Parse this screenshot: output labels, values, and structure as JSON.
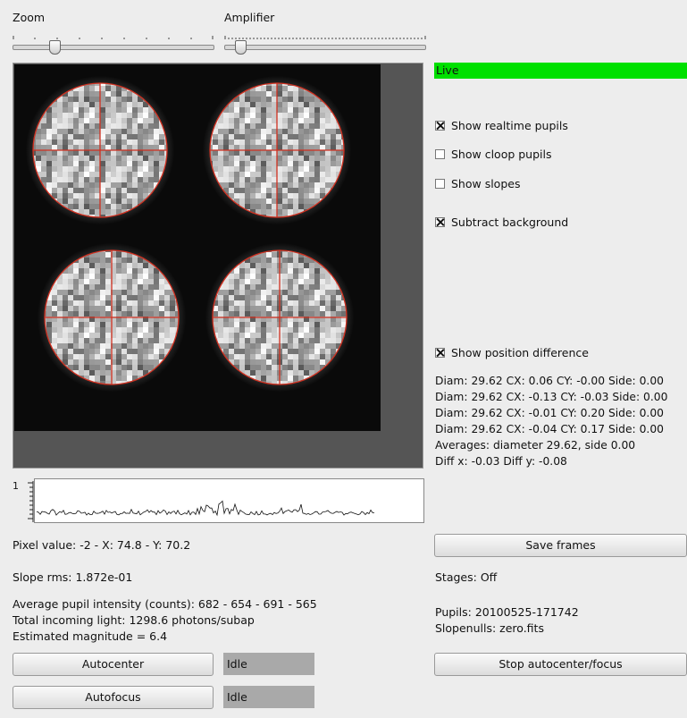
{
  "controls": {
    "zoom_label": "Zoom",
    "zoom_level": 0.21,
    "amplifier_label": "Amplifier",
    "amplifier_level": 0.08
  },
  "status": {
    "live_label": "Live",
    "live_color": "#00e000"
  },
  "options": [
    {
      "label": "Show realtime pupils",
      "checked": true
    },
    {
      "label": "Show cloop pupils",
      "checked": false
    },
    {
      "label": "Show slopes",
      "checked": false
    },
    {
      "label": "Subtract background",
      "checked": true
    }
  ],
  "position_diff": {
    "label": "Show position difference",
    "checked": true,
    "lines": [
      "Diam: 29.62 CX:  0.06  CY: -0.00 Side: 0.00",
      "Diam: 29.62 CX: -0.13  CY: -0.03 Side: 0.00",
      "Diam: 29.62 CX: -0.01  CY:  0.20 Side: 0.00",
      "Diam: 29.62 CX: -0.04  CY:  0.17 Side: 0.00",
      "Averages: diameter 29.62, side  0.00",
      "Diff x: -0.03 Diff y: -0.08"
    ]
  },
  "plot": {
    "ytick": "1"
  },
  "readouts": {
    "pixel_value": "Pixel value: -2 - X:  74.8 - Y:  70.2",
    "slope_rms": "Slope rms: 1.872e-01",
    "avg_intensity": "Average pupil intensity (counts): 682 - 654 - 691 - 565",
    "total_light": "Total incoming light: 1298.6 photons/subap",
    "magnitude": "Estimated magnitude =   6.4"
  },
  "buttons": {
    "save_frames": "Save frames",
    "autocenter": "Autocenter",
    "autofocus": "Autofocus",
    "stop_autocenter": "Stop autocenter/focus"
  },
  "states": {
    "autocenter_state": "Idle",
    "autofocus_state": "Idle"
  },
  "info": {
    "stages": "Stages: Off",
    "pupils": "Pupils: 20100525-171742",
    "slopenulls": "Slopenulls: zero.fits"
  },
  "colors": {
    "pupil_circle": "#d03020",
    "background_panel": "#555555"
  }
}
